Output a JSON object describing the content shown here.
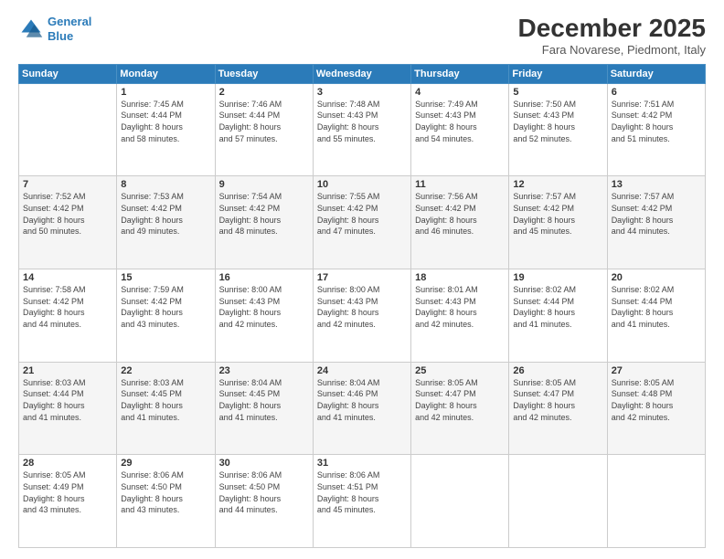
{
  "logo": {
    "line1": "General",
    "line2": "Blue"
  },
  "title": "December 2025",
  "subtitle": "Fara Novarese, Piedmont, Italy",
  "days_of_week": [
    "Sunday",
    "Monday",
    "Tuesday",
    "Wednesday",
    "Thursday",
    "Friday",
    "Saturday"
  ],
  "weeks": [
    [
      {
        "day": "",
        "info": ""
      },
      {
        "day": "1",
        "info": "Sunrise: 7:45 AM\nSunset: 4:44 PM\nDaylight: 8 hours\nand 58 minutes."
      },
      {
        "day": "2",
        "info": "Sunrise: 7:46 AM\nSunset: 4:44 PM\nDaylight: 8 hours\nand 57 minutes."
      },
      {
        "day": "3",
        "info": "Sunrise: 7:48 AM\nSunset: 4:43 PM\nDaylight: 8 hours\nand 55 minutes."
      },
      {
        "day": "4",
        "info": "Sunrise: 7:49 AM\nSunset: 4:43 PM\nDaylight: 8 hours\nand 54 minutes."
      },
      {
        "day": "5",
        "info": "Sunrise: 7:50 AM\nSunset: 4:43 PM\nDaylight: 8 hours\nand 52 minutes."
      },
      {
        "day": "6",
        "info": "Sunrise: 7:51 AM\nSunset: 4:42 PM\nDaylight: 8 hours\nand 51 minutes."
      }
    ],
    [
      {
        "day": "7",
        "info": "Sunrise: 7:52 AM\nSunset: 4:42 PM\nDaylight: 8 hours\nand 50 minutes."
      },
      {
        "day": "8",
        "info": "Sunrise: 7:53 AM\nSunset: 4:42 PM\nDaylight: 8 hours\nand 49 minutes."
      },
      {
        "day": "9",
        "info": "Sunrise: 7:54 AM\nSunset: 4:42 PM\nDaylight: 8 hours\nand 48 minutes."
      },
      {
        "day": "10",
        "info": "Sunrise: 7:55 AM\nSunset: 4:42 PM\nDaylight: 8 hours\nand 47 minutes."
      },
      {
        "day": "11",
        "info": "Sunrise: 7:56 AM\nSunset: 4:42 PM\nDaylight: 8 hours\nand 46 minutes."
      },
      {
        "day": "12",
        "info": "Sunrise: 7:57 AM\nSunset: 4:42 PM\nDaylight: 8 hours\nand 45 minutes."
      },
      {
        "day": "13",
        "info": "Sunrise: 7:57 AM\nSunset: 4:42 PM\nDaylight: 8 hours\nand 44 minutes."
      }
    ],
    [
      {
        "day": "14",
        "info": "Sunrise: 7:58 AM\nSunset: 4:42 PM\nDaylight: 8 hours\nand 44 minutes."
      },
      {
        "day": "15",
        "info": "Sunrise: 7:59 AM\nSunset: 4:42 PM\nDaylight: 8 hours\nand 43 minutes."
      },
      {
        "day": "16",
        "info": "Sunrise: 8:00 AM\nSunset: 4:43 PM\nDaylight: 8 hours\nand 42 minutes."
      },
      {
        "day": "17",
        "info": "Sunrise: 8:00 AM\nSunset: 4:43 PM\nDaylight: 8 hours\nand 42 minutes."
      },
      {
        "day": "18",
        "info": "Sunrise: 8:01 AM\nSunset: 4:43 PM\nDaylight: 8 hours\nand 42 minutes."
      },
      {
        "day": "19",
        "info": "Sunrise: 8:02 AM\nSunset: 4:44 PM\nDaylight: 8 hours\nand 41 minutes."
      },
      {
        "day": "20",
        "info": "Sunrise: 8:02 AM\nSunset: 4:44 PM\nDaylight: 8 hours\nand 41 minutes."
      }
    ],
    [
      {
        "day": "21",
        "info": "Sunrise: 8:03 AM\nSunset: 4:44 PM\nDaylight: 8 hours\nand 41 minutes."
      },
      {
        "day": "22",
        "info": "Sunrise: 8:03 AM\nSunset: 4:45 PM\nDaylight: 8 hours\nand 41 minutes."
      },
      {
        "day": "23",
        "info": "Sunrise: 8:04 AM\nSunset: 4:45 PM\nDaylight: 8 hours\nand 41 minutes."
      },
      {
        "day": "24",
        "info": "Sunrise: 8:04 AM\nSunset: 4:46 PM\nDaylight: 8 hours\nand 41 minutes."
      },
      {
        "day": "25",
        "info": "Sunrise: 8:05 AM\nSunset: 4:47 PM\nDaylight: 8 hours\nand 42 minutes."
      },
      {
        "day": "26",
        "info": "Sunrise: 8:05 AM\nSunset: 4:47 PM\nDaylight: 8 hours\nand 42 minutes."
      },
      {
        "day": "27",
        "info": "Sunrise: 8:05 AM\nSunset: 4:48 PM\nDaylight: 8 hours\nand 42 minutes."
      }
    ],
    [
      {
        "day": "28",
        "info": "Sunrise: 8:05 AM\nSunset: 4:49 PM\nDaylight: 8 hours\nand 43 minutes."
      },
      {
        "day": "29",
        "info": "Sunrise: 8:06 AM\nSunset: 4:50 PM\nDaylight: 8 hours\nand 43 minutes."
      },
      {
        "day": "30",
        "info": "Sunrise: 8:06 AM\nSunset: 4:50 PM\nDaylight: 8 hours\nand 44 minutes."
      },
      {
        "day": "31",
        "info": "Sunrise: 8:06 AM\nSunset: 4:51 PM\nDaylight: 8 hours\nand 45 minutes."
      },
      {
        "day": "",
        "info": ""
      },
      {
        "day": "",
        "info": ""
      },
      {
        "day": "",
        "info": ""
      }
    ]
  ]
}
